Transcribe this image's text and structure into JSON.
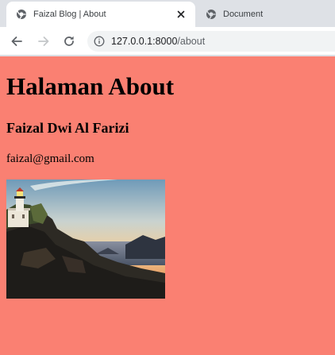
{
  "browser": {
    "tabs": [
      {
        "title": "Faizal Blog | About",
        "active": true
      },
      {
        "title": "Document",
        "active": false
      }
    ],
    "address": {
      "host": "127.0.0.1:8000",
      "path": "/about"
    },
    "icons": {
      "tab_favicon": "globe-icon",
      "tab_close": "close-icon",
      "back": "arrow-left-icon",
      "forward": "arrow-right-icon",
      "reload": "reload-icon",
      "site_info": "info-icon"
    }
  },
  "page": {
    "heading": "Halaman About",
    "name": "Faizal Dwi Al Farizi",
    "email": "faizal@gmail.com",
    "background_color": "#fa8072",
    "image": "lighthouse-photo"
  }
}
